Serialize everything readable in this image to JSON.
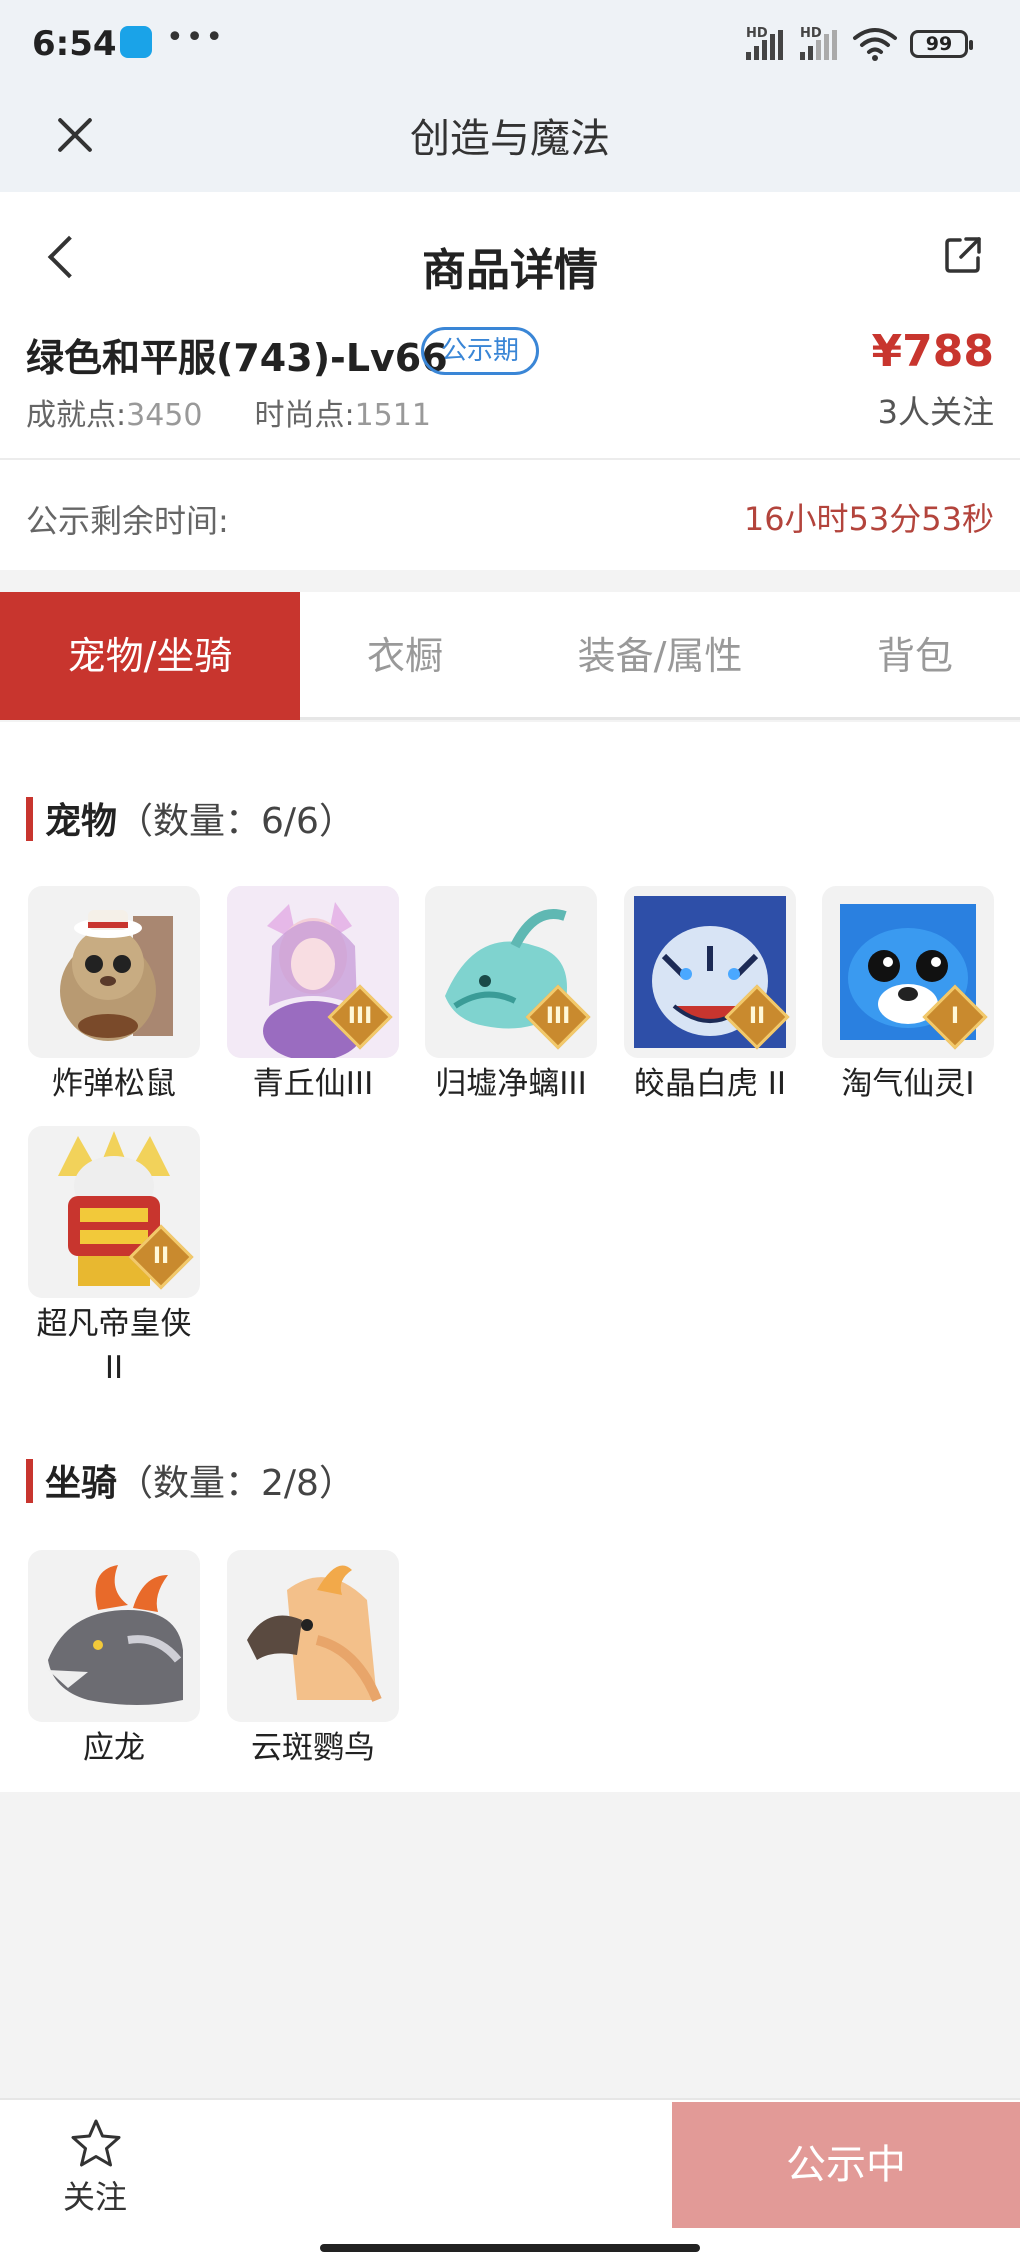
{
  "status": {
    "time": "6:54",
    "dots": "•••",
    "network1": "HD",
    "network2": "HD",
    "battery": "99"
  },
  "titlebar": {
    "title": "创造与魔法"
  },
  "nav": {
    "title": "商品详情"
  },
  "item": {
    "name": "绿色和平服(743)-Lv66",
    "badge": "公示期",
    "price": "¥788",
    "achievement_label": "成就点:",
    "achievement_value": "3450",
    "fashion_label": "时尚点:",
    "fashion_value": "1511",
    "followers": "3人关注",
    "remain_label": "公示剩余时间:",
    "remain_value": "16小时53分53秒"
  },
  "tabs": [
    "宠物/坐骑",
    "衣橱",
    "装备/属性",
    "背包"
  ],
  "pets": {
    "title": "宠物",
    "count": "（数量：6/6）",
    "items": [
      {
        "name": "炸弹松鼠",
        "tier": ""
      },
      {
        "name": "青丘仙III",
        "tier": "III"
      },
      {
        "name": "归墟净螭III",
        "tier": "III"
      },
      {
        "name": "皎晶白虎 II",
        "tier": "II"
      },
      {
        "name": "淘气仙灵I",
        "tier": "I"
      },
      {
        "name": "超凡帝皇侠II",
        "tier": "II"
      }
    ]
  },
  "mounts": {
    "title": "坐骑",
    "count": "（数量：2/8）",
    "items": [
      {
        "name": "应龙"
      },
      {
        "name": "云斑鹦鸟"
      }
    ]
  },
  "bottom": {
    "follow_label": "关注",
    "notice_label": "公示中"
  },
  "colors": {
    "accent": "#c8352e",
    "badge_blue": "#3a86d6",
    "notice_btn": "#e29a97"
  }
}
